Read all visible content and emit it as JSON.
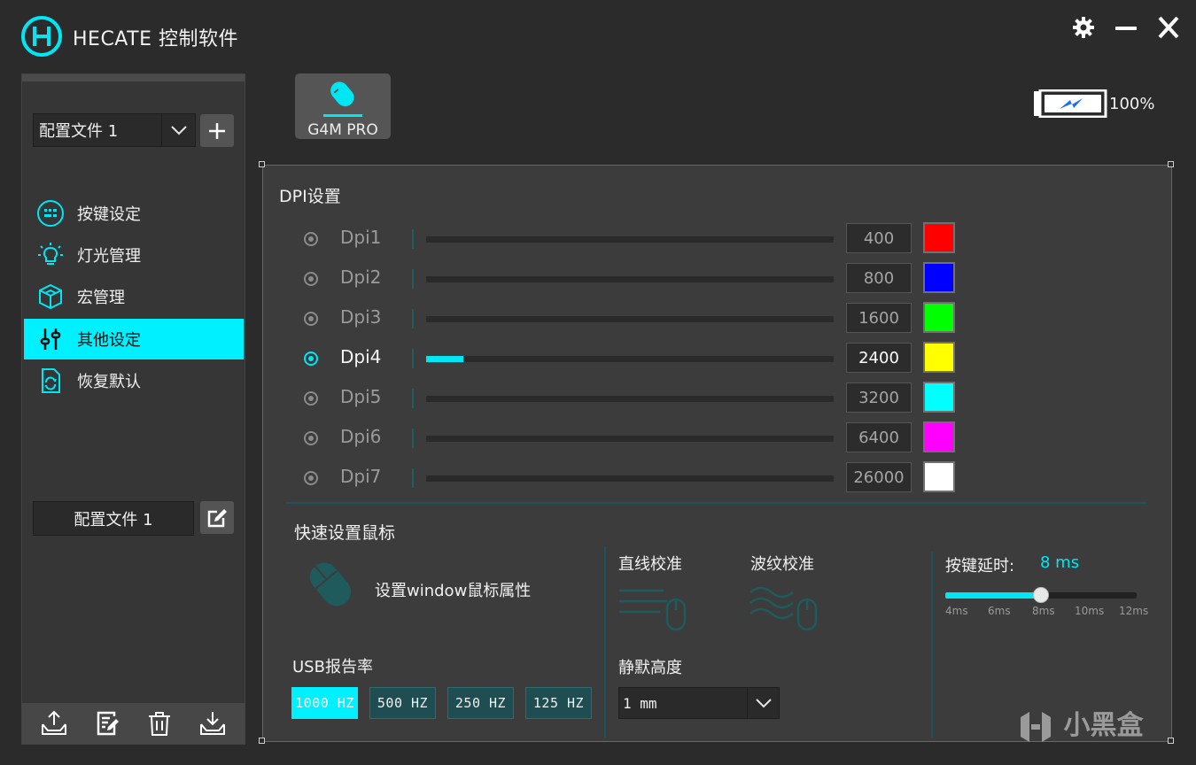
{
  "app": {
    "title": "HECATE 控制软件",
    "accent_color": "#00f0ff"
  },
  "window_controls": [
    {
      "name": "settings",
      "icon": "gear-icon"
    },
    {
      "name": "minimize",
      "icon": "minimize-icon"
    },
    {
      "name": "close",
      "icon": "close-icon"
    }
  ],
  "sidebar": {
    "profile_select": {
      "value": "配置文件 1"
    },
    "nav": [
      {
        "label": "按键设定",
        "icon": "keyboard-icon",
        "active": false
      },
      {
        "label": "灯光管理",
        "icon": "lightbulb-icon",
        "active": false
      },
      {
        "label": "宏管理",
        "icon": "cube-icon",
        "active": false
      },
      {
        "label": "其他设定",
        "icon": "sliders-icon",
        "active": true
      },
      {
        "label": "恢复默认",
        "icon": "restore-icon",
        "active": false
      }
    ],
    "profile_name": "配置文件 1",
    "bottom_actions": [
      {
        "name": "export",
        "icon": "export-icon"
      },
      {
        "name": "notes",
        "icon": "document-icon"
      },
      {
        "name": "delete",
        "icon": "trash-icon"
      },
      {
        "name": "import",
        "icon": "import-icon"
      }
    ]
  },
  "device": {
    "name": "G4M PRO"
  },
  "battery": {
    "level": 100,
    "text": "100%"
  },
  "dpi": {
    "title": "DPI设置",
    "max_value": 26000,
    "levels": [
      {
        "label": "Dpi1",
        "value": "400",
        "color": "#ff0000",
        "active": false
      },
      {
        "label": "Dpi2",
        "value": "800",
        "color": "#0000ff",
        "active": false
      },
      {
        "label": "Dpi3",
        "value": "1600",
        "color": "#00ff00",
        "active": false
      },
      {
        "label": "Dpi4",
        "value": "2400",
        "color": "#ffff00",
        "active": true
      },
      {
        "label": "Dpi5",
        "value": "3200",
        "color": "#00ffff",
        "active": false
      },
      {
        "label": "Dpi6",
        "value": "6400",
        "color": "#ff00ff",
        "active": false
      },
      {
        "label": "Dpi7",
        "value": "26000",
        "color": "#ffffff",
        "active": false
      }
    ]
  },
  "quick": {
    "title": "快速设置鼠标",
    "windows_mouse": "设置window鼠标属性",
    "usb_rate": {
      "title": "USB报告率",
      "options": [
        {
          "label": "1000 HZ",
          "active": true
        },
        {
          "label": "500 HZ",
          "active": false
        },
        {
          "label": "250 HZ",
          "active": false
        },
        {
          "label": "125 HZ",
          "active": false
        }
      ]
    },
    "straight_calibration": "直线校准",
    "ripple_calibration": "波纹校准",
    "lift_off": {
      "title": "静默高度",
      "value": "1 mm"
    },
    "key_delay": {
      "title": "按键延时:",
      "value_text": "8 ms",
      "value": 8,
      "min": 4,
      "max": 12,
      "ticks": [
        "4ms",
        "6ms",
        "8ms",
        "10ms",
        "12ms"
      ]
    }
  },
  "watermark": "小黑盒"
}
